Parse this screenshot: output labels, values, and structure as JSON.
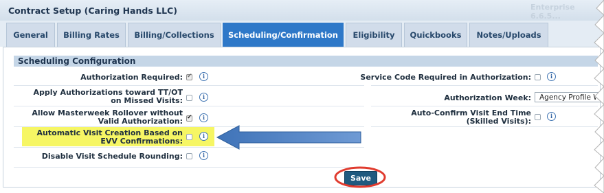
{
  "window": {
    "title": "Contract Setup (Caring Hands LLC)",
    "version": "Enterprise 6.6.5..."
  },
  "tabs": [
    {
      "label": "General",
      "active": false
    },
    {
      "label": "Billing Rates",
      "active": false
    },
    {
      "label": "Billing/Collections",
      "active": false
    },
    {
      "label": "Scheduling/Confirmation",
      "active": true
    },
    {
      "label": "Eligibility",
      "active": false
    },
    {
      "label": "Quickbooks",
      "active": false
    },
    {
      "label": "Notes/Uploads",
      "active": false
    }
  ],
  "section": {
    "title": "Scheduling Configuration"
  },
  "left_settings": [
    {
      "label": "Authorization Required:",
      "checked": true,
      "disabled": true
    },
    {
      "label": "Apply Authorizations toward TT/OT on Missed Visits:",
      "checked": false
    },
    {
      "label": "Allow Masterweek Rollover without Valid Authorization:",
      "checked": true
    },
    {
      "label": "Automatic Visit Creation Based on EVV Confirmations:",
      "checked": false,
      "highlighted": true
    },
    {
      "label": "Disable Visit Schedule Rounding:",
      "checked": false
    }
  ],
  "right_settings": {
    "service_code": {
      "label": "Service Code Required in Authorization:",
      "checked": false
    },
    "auth_week": {
      "label": "Authorization Week:",
      "value": "Agency Profile Week"
    },
    "auto_confirm": {
      "label": "Auto-Confirm Visit End Time (Skilled Visits):",
      "checked": false
    }
  },
  "info_glyph": "i",
  "save_label": "Save",
  "annotations": {
    "arrow_color": "#4a7fc2",
    "circle_color": "#e03b2e"
  }
}
